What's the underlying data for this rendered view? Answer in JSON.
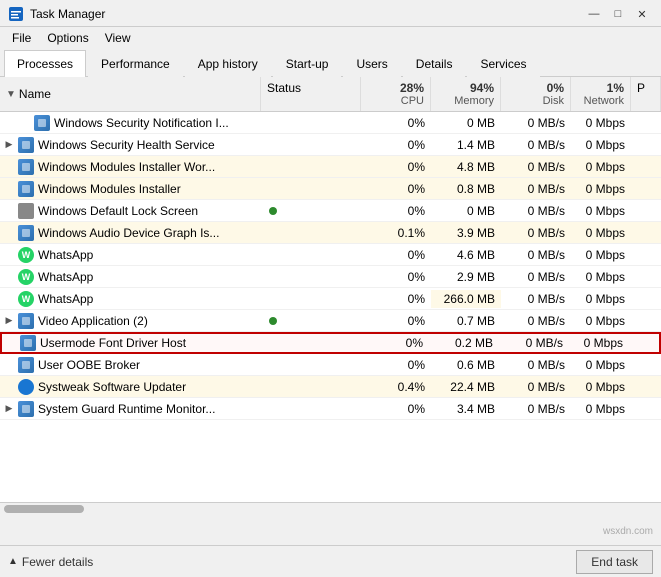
{
  "titleBar": {
    "title": "Task Manager",
    "minBtn": "—",
    "maxBtn": "□",
    "closeBtn": "✕"
  },
  "menuBar": {
    "items": [
      "File",
      "Options",
      "View"
    ]
  },
  "tabs": [
    {
      "label": "Processes",
      "active": true
    },
    {
      "label": "Performance",
      "active": false
    },
    {
      "label": "App history",
      "active": false
    },
    {
      "label": "Start-up",
      "active": false
    },
    {
      "label": "Users",
      "active": false
    },
    {
      "label": "Details",
      "active": false
    },
    {
      "label": "Services",
      "active": false
    }
  ],
  "columns": {
    "name": "Name",
    "status": "Status",
    "cpu": {
      "percent": "28%",
      "label": "CPU"
    },
    "memory": {
      "percent": "94%",
      "label": "Memory"
    },
    "disk": {
      "percent": "0%",
      "label": "Disk"
    },
    "network": {
      "percent": "1%",
      "label": "Network"
    },
    "power": "P"
  },
  "rows": [
    {
      "name": "Windows Security Notification I...",
      "status": "",
      "cpu": "0%",
      "memory": "0 MB",
      "disk": "0 MB/s",
      "network": "0 Mbps",
      "icon": "generic",
      "expandable": false,
      "shaded": false,
      "indent": true
    },
    {
      "name": "Windows Security Health Service",
      "status": "",
      "cpu": "0%",
      "memory": "1.4 MB",
      "disk": "0 MB/s",
      "network": "0 Mbps",
      "icon": "generic",
      "expandable": true,
      "shaded": false,
      "indent": false
    },
    {
      "name": "Windows Modules Installer Wor...",
      "status": "",
      "cpu": "0%",
      "memory": "4.8 MB",
      "disk": "0 MB/s",
      "network": "0 Mbps",
      "icon": "generic",
      "expandable": false,
      "shaded": true,
      "indent": false
    },
    {
      "name": "Windows Modules Installer",
      "status": "",
      "cpu": "0%",
      "memory": "0.8 MB",
      "disk": "0 MB/s",
      "network": "0 Mbps",
      "icon": "generic",
      "expandable": false,
      "shaded": true,
      "indent": false
    },
    {
      "name": "Windows Default Lock Screen",
      "status": "",
      "cpu": "0%",
      "memory": "0 MB",
      "disk": "0 MB/s",
      "network": "0 Mbps",
      "icon": "gray",
      "expandable": false,
      "shaded": false,
      "plant": true,
      "indent": false
    },
    {
      "name": "Windows Audio Device Graph Is...",
      "status": "",
      "cpu": "0.1%",
      "memory": "3.9 MB",
      "disk": "0 MB/s",
      "network": "0 Mbps",
      "icon": "generic",
      "expandable": false,
      "shaded": true,
      "indent": false
    },
    {
      "name": "WhatsApp",
      "status": "",
      "cpu": "0%",
      "memory": "4.6 MB",
      "disk": "0 MB/s",
      "network": "0 Mbps",
      "icon": "whatsapp",
      "expandable": false,
      "shaded": false,
      "indent": false
    },
    {
      "name": "WhatsApp",
      "status": "",
      "cpu": "0%",
      "memory": "2.9 MB",
      "disk": "0 MB/s",
      "network": "0 Mbps",
      "icon": "whatsapp",
      "expandable": false,
      "shaded": false,
      "indent": false
    },
    {
      "name": "WhatsApp",
      "status": "",
      "cpu": "0%",
      "memory": "266.0 MB",
      "disk": "0 MB/s",
      "network": "0 Mbps",
      "icon": "whatsapp",
      "expandable": false,
      "shaded": false,
      "indent": false
    },
    {
      "name": "Video Application (2)",
      "status": "",
      "cpu": "0%",
      "memory": "0.7 MB",
      "disk": "0 MB/s",
      "network": "0 Mbps",
      "icon": "generic",
      "expandable": true,
      "shaded": false,
      "plant": true,
      "indent": false
    },
    {
      "name": "Usermode Font Driver Host",
      "status": "",
      "cpu": "0%",
      "memory": "0.2 MB",
      "disk": "0 MB/s",
      "network": "0 Mbps",
      "icon": "generic",
      "expandable": false,
      "shaded": false,
      "highlighted": true,
      "indent": false
    },
    {
      "name": "User OOBE Broker",
      "status": "",
      "cpu": "0%",
      "memory": "0.6 MB",
      "disk": "0 MB/s",
      "network": "0 Mbps",
      "icon": "generic",
      "expandable": false,
      "shaded": false,
      "indent": false
    },
    {
      "name": "Systweak Software Updater",
      "status": "",
      "cpu": "0.4%",
      "memory": "22.4 MB",
      "disk": "0 MB/s",
      "network": "0 Mbps",
      "icon": "circle-blue",
      "expandable": false,
      "shaded": true,
      "indent": false
    },
    {
      "name": "System Guard Runtime Monitor...",
      "status": "",
      "cpu": "0%",
      "memory": "3.4 MB",
      "disk": "0 MB/s",
      "network": "0 Mbps",
      "icon": "generic",
      "expandable": true,
      "shaded": false,
      "indent": false
    }
  ],
  "bottomBar": {
    "fewerDetails": "Fewer details",
    "endTask": "End task"
  },
  "watermark": "wsxdn.com"
}
